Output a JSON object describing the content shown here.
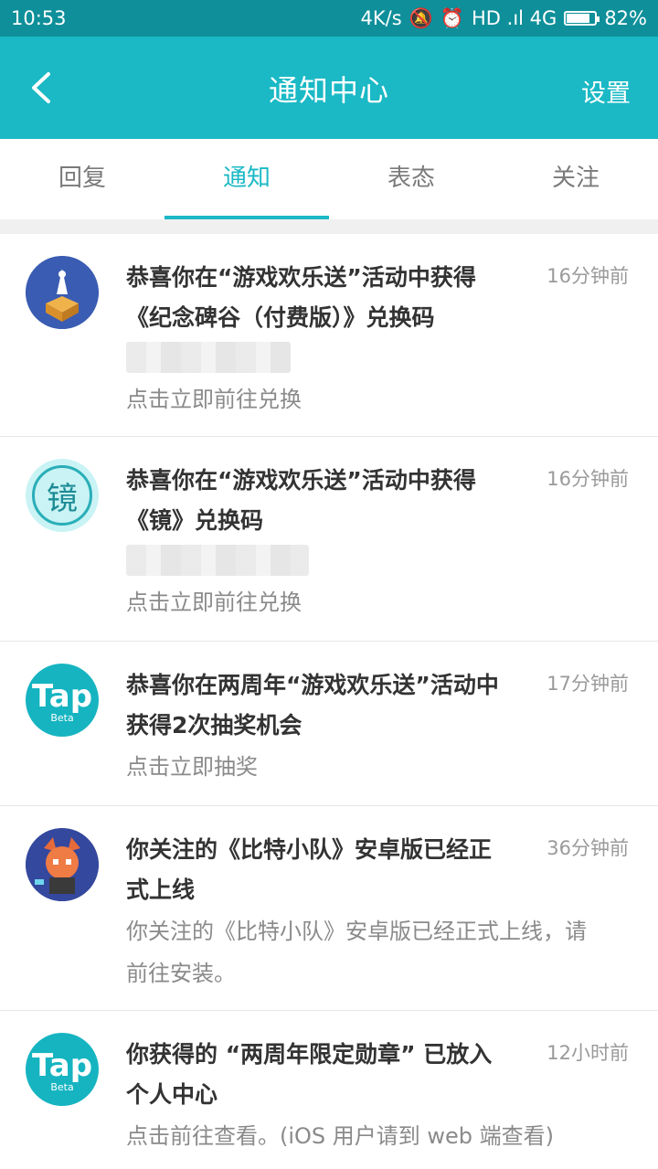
{
  "status": {
    "time": "10:53",
    "net_speed": "4K/s",
    "network": "HD .ıl 4G",
    "battery": "82%",
    "battery_level": 0.82
  },
  "appbar": {
    "title": "通知中心",
    "settings_label": "设置",
    "back_icon": "chevron-left-icon"
  },
  "tabs": [
    {
      "label": "回复"
    },
    {
      "label": "通知"
    },
    {
      "label": "表态"
    },
    {
      "label": "关注"
    }
  ],
  "active_tab": "通知",
  "notifications": [
    {
      "title": "恭喜你在“游戏欢乐送”活动中获得《纪念碑谷（付费版）》兑换码",
      "time": "16分钟前",
      "sub": "点击立即前往兑换",
      "avatar": "monument-valley-icon"
    },
    {
      "title": "恭喜你在“游戏欢乐送”活动中获得《镜》兑换码",
      "time": "16分钟前",
      "sub": "点击立即前往兑换",
      "avatar": "mirror-game-icon",
      "avatar_text": "镜"
    },
    {
      "title": "恭喜你在两周年“游戏欢乐送”活动中获得2次抽奖机会",
      "time": "17分钟前",
      "sub": "点击立即抽奖",
      "avatar": "tap-logo-icon",
      "logo_text": "Tap",
      "logo_sub": "Beta"
    },
    {
      "title": "你关注的《比特小队》安卓版已经正式上线",
      "time": "36分钟前",
      "sub": "你关注的《比特小队》安卓版已经正式上线，请前往安装。",
      "avatar": "bit-squad-icon"
    },
    {
      "title": "你获得的 “两周年限定勋章” 已放入个人中心",
      "time": "12小时前",
      "sub": "点击前往查看。(iOS 用户请到 web 端查看)",
      "avatar": "tap-logo-icon",
      "logo_text": "Tap",
      "logo_sub": "Beta"
    }
  ],
  "colors": {
    "accent": "#1ab9c5",
    "statusbar": "#0e8f9a"
  }
}
